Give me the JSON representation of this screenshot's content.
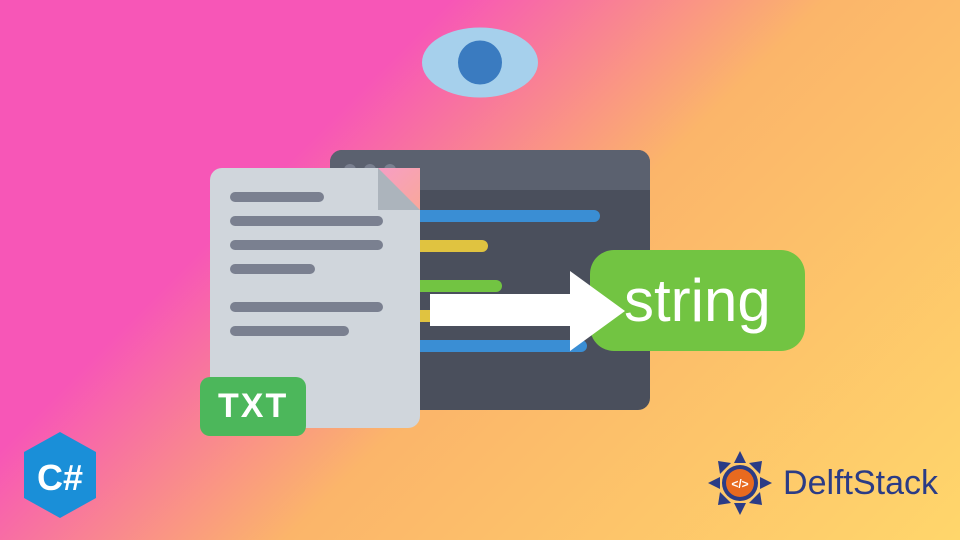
{
  "illustration": {
    "doc_badge": "TXT",
    "string_badge": "string",
    "code_colors": {
      "blue": "#3a8ed4",
      "yellow": "#e0c340",
      "green": "#72c442"
    }
  },
  "branding": {
    "csharp": "C#",
    "site_name": "DelftStack",
    "site_glyph": "</>"
  },
  "colors": {
    "eye_outer": "#a6d0ec",
    "eye_pupil": "#3a7bc0",
    "csharp_bg": "#1a8fd8",
    "delft_accent": "#2b3c86",
    "delft_orange": "#e86a1f"
  }
}
